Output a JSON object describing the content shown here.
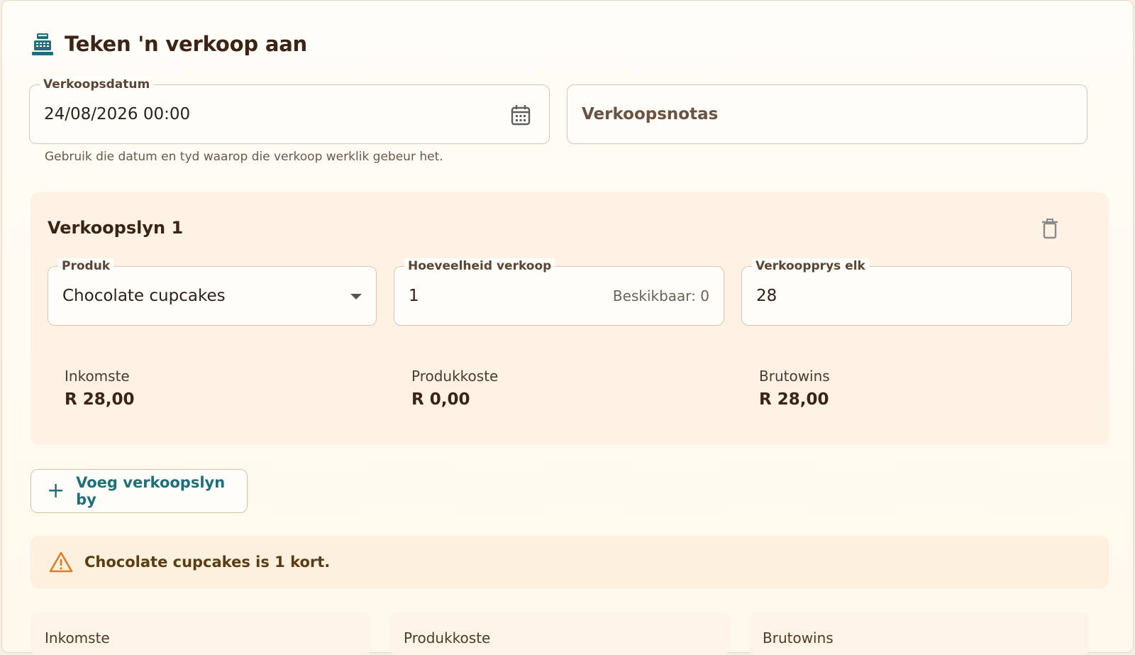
{
  "header": {
    "title": "Teken 'n verkoop aan",
    "icon": "cash-register-icon"
  },
  "sale_date": {
    "label": "Verkoopsdatum",
    "value": "24/08/2026 00:00",
    "helper": "Gebruik die datum en tyd waarop die verkoop werklik gebeur het.",
    "icon": "calendar-icon"
  },
  "notes": {
    "placeholder": "Verkoopsnotas"
  },
  "sale_line": {
    "title": "Verkoopslyn 1",
    "delete_icon": "trash-icon",
    "product": {
      "label": "Produk",
      "value": "Chocolate cupcakes"
    },
    "quantity": {
      "label": "Hoeveelheid verkoop",
      "value": "1",
      "available": "Beskikbaar: 0"
    },
    "price": {
      "label": "Verkoopprys elk",
      "value": "28"
    },
    "metrics": {
      "income": {
        "label": "Inkomste",
        "value": "R 28,00"
      },
      "cost": {
        "label": "Produkkoste",
        "value": "R 0,00"
      },
      "profit": {
        "label": "Brutowins",
        "value": "R 28,00"
      }
    }
  },
  "add_line": {
    "label": "Voeg verkoopslyn by",
    "icon": "plus-icon"
  },
  "warning": {
    "text": "Chocolate cupcakes is 1 kort.",
    "icon": "warning-icon"
  },
  "summary": {
    "income_label": "Inkomste",
    "cost_label": "Produkkoste",
    "profit_label": "Brutowins"
  },
  "colors": {
    "accent": "#1f6f7a",
    "warning": "#e07b2a",
    "panel": "#fdf2e3"
  }
}
